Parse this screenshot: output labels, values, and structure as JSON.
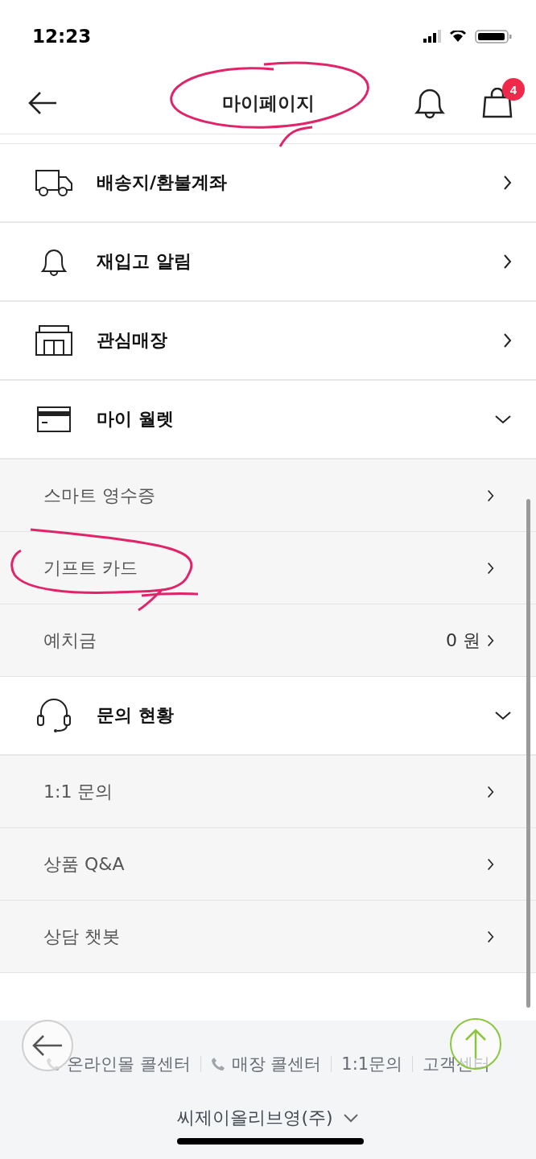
{
  "status_bar": {
    "time": "12:23"
  },
  "header": {
    "title": "마이페이지",
    "cart_count": "4"
  },
  "menu": [
    {
      "label": "배송지/환불계좌",
      "expanded": false
    },
    {
      "label": "재입고 알림",
      "expanded": false
    },
    {
      "label": "관심매장",
      "expanded": false
    },
    {
      "label": "마이 월렛",
      "expanded": true,
      "children": [
        {
          "label": "스마트 영수증"
        },
        {
          "label": "기프트 카드"
        },
        {
          "label": "예치금",
          "value": "0 원"
        }
      ]
    },
    {
      "label": "문의 현황",
      "expanded": true,
      "children": [
        {
          "label": "1:1 문의"
        },
        {
          "label": "상품 Q&A"
        },
        {
          "label": "상담 챗봇"
        }
      ]
    }
  ],
  "footer": {
    "links": [
      {
        "label": "온라인몰 콜센터",
        "kind": "phone"
      },
      {
        "label": "매장 콜센터",
        "kind": "phone"
      },
      {
        "label": "1:1문의",
        "kind": "plain"
      },
      {
        "label": "고객센터",
        "kind": "plain"
      }
    ],
    "company": "씨제이올리브영(주)"
  }
}
